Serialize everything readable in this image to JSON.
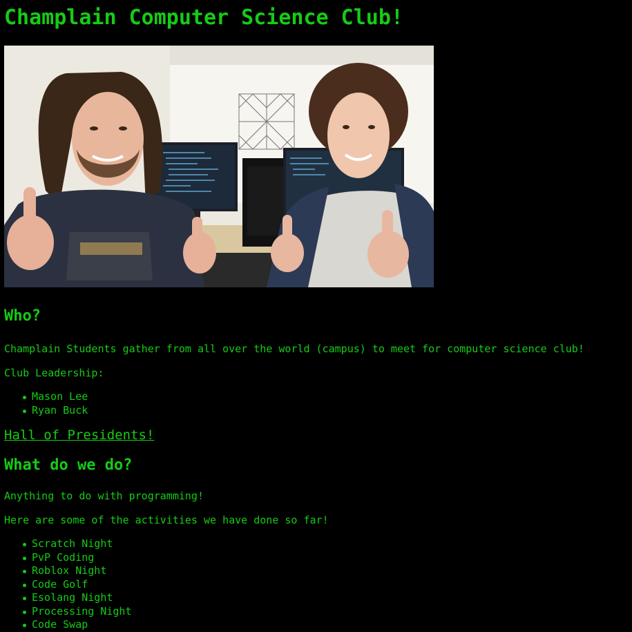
{
  "page": {
    "title": "Champlain Computer Science Club!",
    "photo_alt": "Two club leaders giving thumbs up in a computer lab"
  },
  "who": {
    "heading": "Who?",
    "description": "Champlain Students gather from all over the world (campus) to meet for computer science club!",
    "leadership_label": "Club Leadership:",
    "leaders": [
      "Mason Lee",
      "Ryan Buck"
    ],
    "hall_link": "Hall of Presidents!"
  },
  "what": {
    "heading": "What do we do?",
    "description": "Anything to do with programming!",
    "activities_intro": "Here are some of the activities we have done so far!",
    "activities": [
      "Scratch Night",
      "PvP Coding",
      "Roblox Night",
      "Code Golf",
      "Esolang Night",
      "Processing Night",
      "Code Swap"
    ]
  },
  "colors": {
    "background": "#000000",
    "text": "#15cc15"
  }
}
